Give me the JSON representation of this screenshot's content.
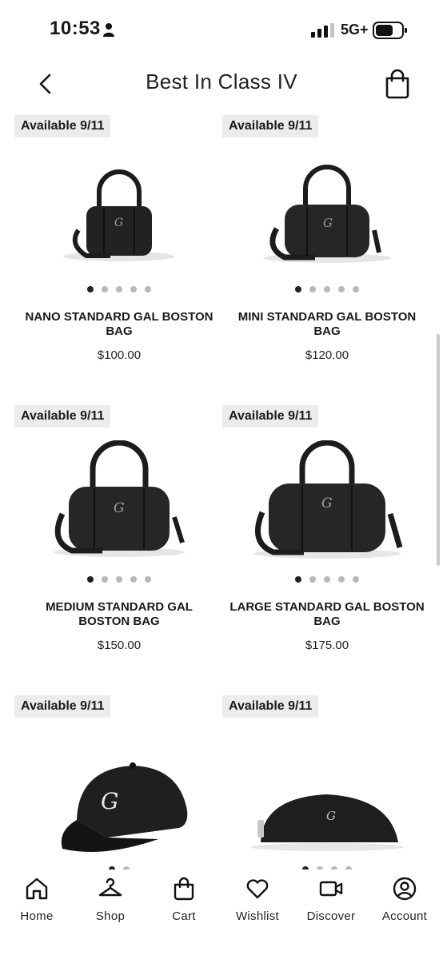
{
  "status_bar": {
    "time": "10:53",
    "network": "5G+"
  },
  "header": {
    "title": "Best In Class IV"
  },
  "products": [
    {
      "badge": "Available 9/11",
      "name": "NANO STANDARD GAL BOSTON BAG",
      "price": "$100.00",
      "image_icon": "bag-icon",
      "image_count": 5,
      "active_image": 1
    },
    {
      "badge": "Available 9/11",
      "name": "MINI STANDARD GAL BOSTON BAG",
      "price": "$120.00",
      "image_icon": "bag-icon",
      "image_count": 5,
      "active_image": 1
    },
    {
      "badge": "Available 9/11",
      "name": "MEDIUM STANDARD GAL BOSTON BAG",
      "price": "$150.00",
      "image_icon": "bag-icon",
      "image_count": 5,
      "active_image": 1
    },
    {
      "badge": "Available 9/11",
      "name": "LARGE STANDARD GAL BOSTON BAG",
      "price": "$175.00",
      "image_icon": "bag-icon",
      "image_count": 5,
      "active_image": 1
    },
    {
      "badge": "Available 9/11",
      "image_icon": "cap-icon",
      "image_count": 2,
      "active_image": 1
    },
    {
      "badge": "Available 9/11",
      "image_icon": "pouch-icon",
      "image_count": 4,
      "active_image": 1
    }
  ],
  "bottom_nav": [
    {
      "label": "Home",
      "icon": "home-icon"
    },
    {
      "label": "Shop",
      "icon": "hanger-icon"
    },
    {
      "label": "Cart",
      "icon": "cart-icon"
    },
    {
      "label": "Wishlist",
      "icon": "heart-icon"
    },
    {
      "label": "Discover",
      "icon": "video-icon"
    },
    {
      "label": "Account",
      "icon": "account-icon"
    }
  ]
}
